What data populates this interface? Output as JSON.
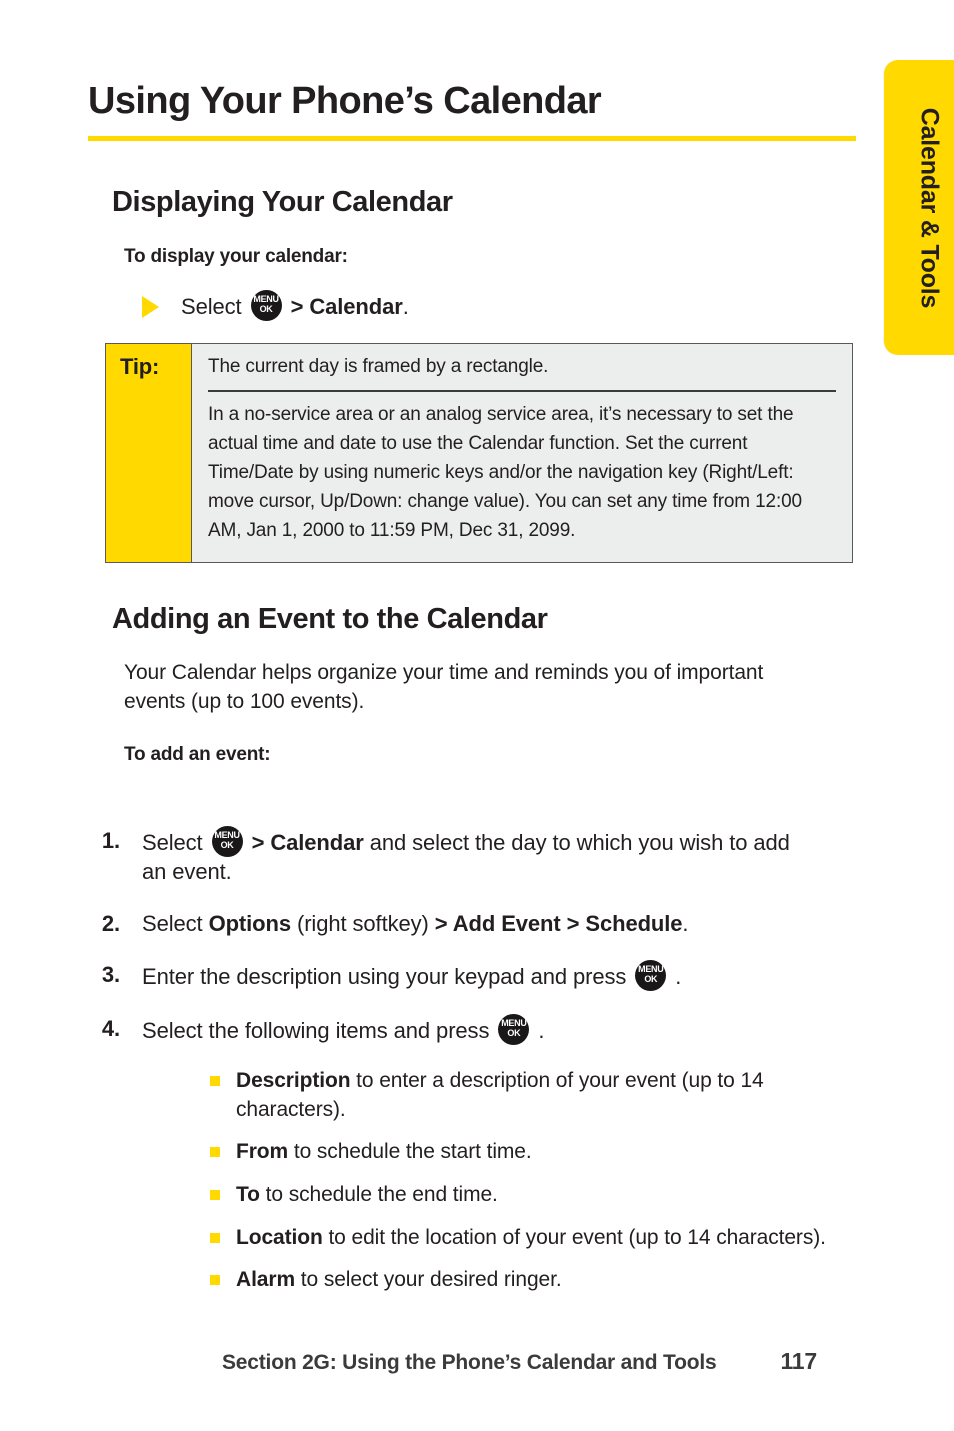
{
  "colors": {
    "accent_yellow": "#FFD900",
    "text": "#231f20",
    "tip_bg": "#eceded",
    "tip_border": "#58595b"
  },
  "side_tab": {
    "label": "Calendar & Tools"
  },
  "page_title": "Using Your Phone’s Calendar",
  "section_display": {
    "heading": "Displaying Your Calendar",
    "subheading": "To display your calendar:",
    "step": {
      "prefix": "Select ",
      "key_icon_top": "MENU",
      "key_icon_bottom": "OK",
      "separator": " > ",
      "bold_target": "Calendar",
      "suffix": "."
    }
  },
  "tip": {
    "label": "Tip:",
    "line_1": "The current day is framed by a rectangle.",
    "line_2": "In a no-service area or an analog service area, it’s necessary to set the actual time and date to use the Calendar function. Set the current Time/Date by using numeric keys and/or the navigation key (Right/Left: move cursor, Up/Down: change value). You can set any time from 12:00 AM, Jan 1, 2000 to 11:59 PM, Dec 31, 2099."
  },
  "section_adding": {
    "heading": "Adding an Event to the Calendar",
    "intro": "Your Calendar helps organize your time and reminds you of important events (up to 100 events).",
    "subheading": "To add an event:",
    "steps": [
      {
        "num": "1.",
        "pre": "Select ",
        "key_top": "MENU",
        "key_bottom": "OK",
        "sep": " > ",
        "bold": "Calendar",
        "post": " and select the day to which you wish to add an event."
      },
      {
        "num": "2.",
        "pre": "Select ",
        "bold1": "Options",
        "mid1": " (right softkey) ",
        "sep1": "> ",
        "bold2": "Add Event ",
        "sep2": "> ",
        "bold3": "Schedule",
        "post": "."
      },
      {
        "num": "3.",
        "pre": "Enter the description using your keypad and press ",
        "key_top": "MENU",
        "key_bottom": "OK",
        "post": " ."
      },
      {
        "num": "4.",
        "pre": "Select the following items and press ",
        "key_top": "MENU",
        "key_bottom": "OK",
        "post": " ."
      }
    ],
    "sub_items": [
      {
        "term": "Description",
        "desc": " to enter a description of your event (up to 14 characters)."
      },
      {
        "term": "From",
        "desc": " to schedule the start time."
      },
      {
        "term": "To",
        "desc": " to schedule the end time."
      },
      {
        "term": "Location",
        "desc": " to edit the location of your event (up to 14 characters)."
      },
      {
        "term": "Alarm",
        "desc": " to select your desired ringer."
      }
    ]
  },
  "footer": {
    "section": "Section 2G: Using the Phone’s Calendar and Tools",
    "page_number": "117"
  }
}
